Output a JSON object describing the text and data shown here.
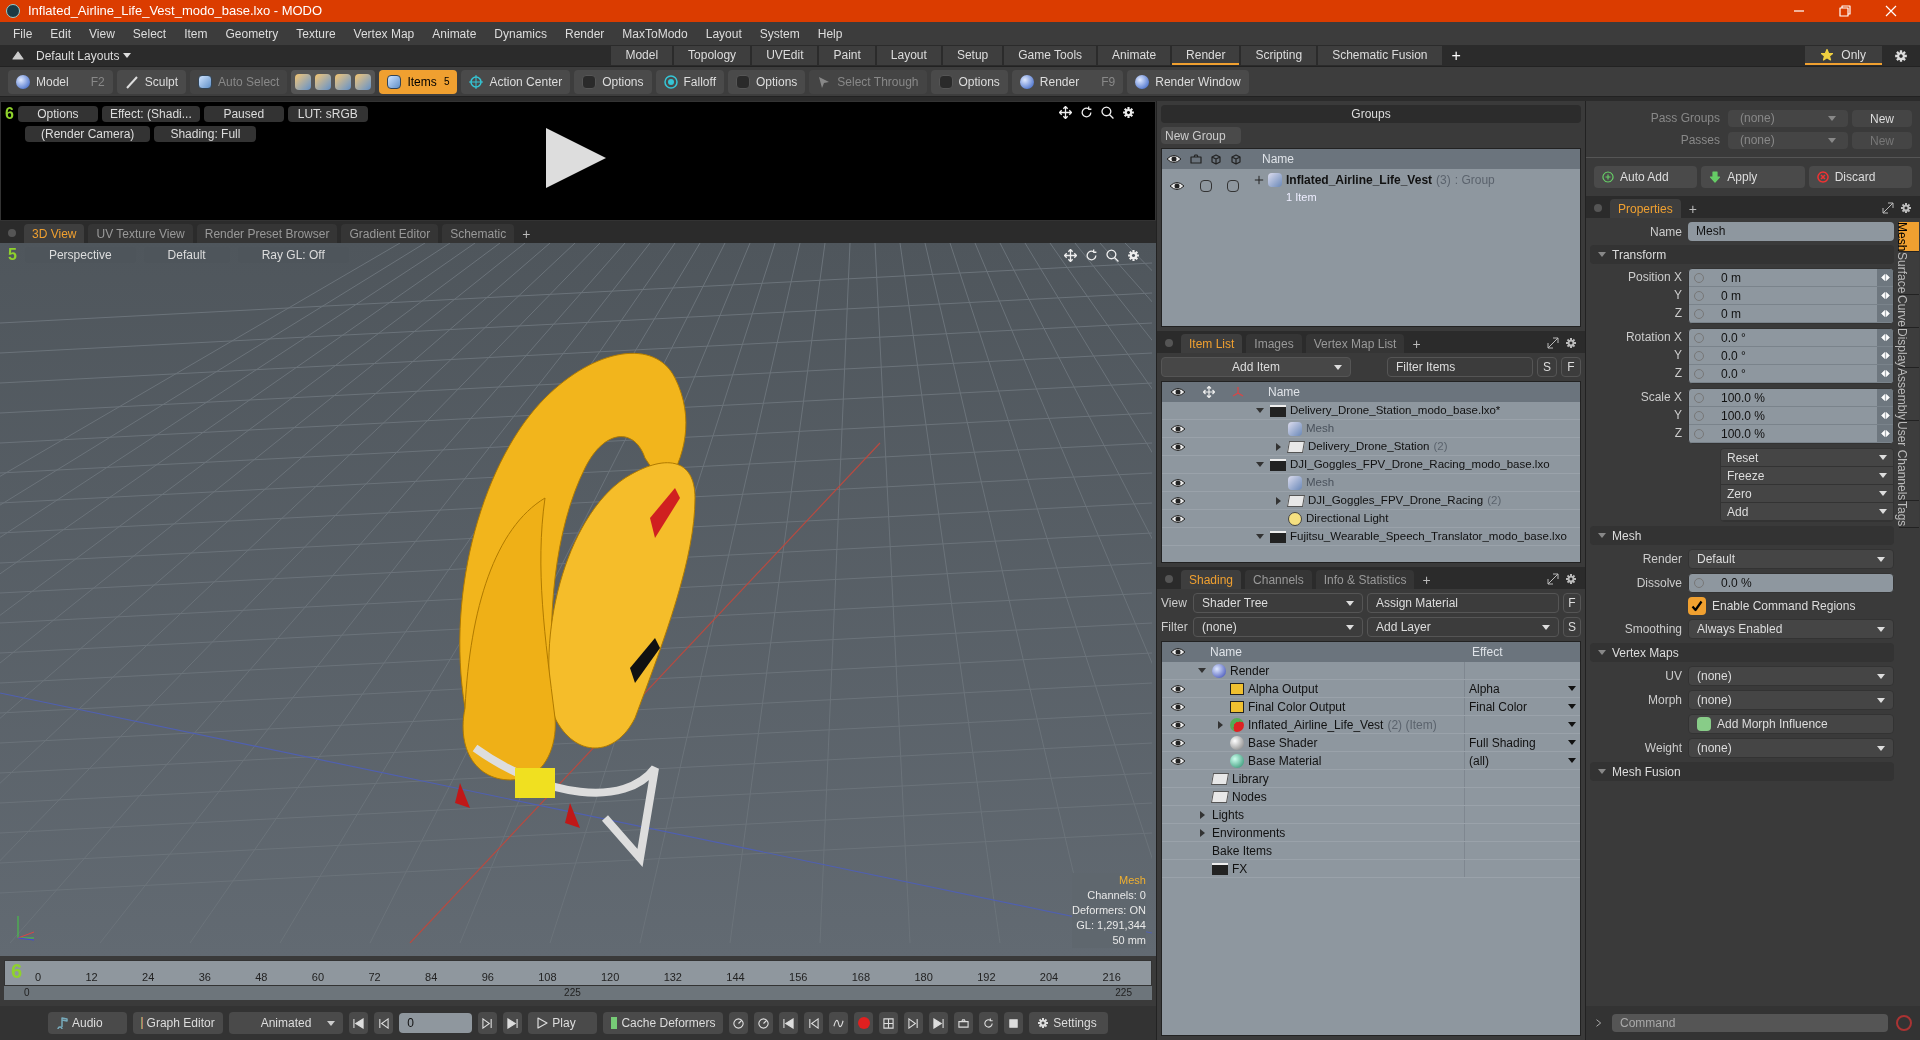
{
  "window": {
    "title": "Inflated_Airline_Life_Vest_modo_base.lxo - MODO"
  },
  "menu": [
    "File",
    "Edit",
    "View",
    "Select",
    "Item",
    "Geometry",
    "Texture",
    "Vertex Map",
    "Animate",
    "Dynamics",
    "Render",
    "MaxToModo",
    "Layout",
    "System",
    "Help"
  ],
  "layout_bar": {
    "layouts": "Default Layouts",
    "add": "+",
    "only": "Only",
    "tabs": [
      {
        "label": "Model",
        "selected": false
      },
      {
        "label": "Topology",
        "selected": false
      },
      {
        "label": "UVEdit",
        "selected": false
      },
      {
        "label": "Paint",
        "selected": false
      },
      {
        "label": "Layout",
        "selected": false
      },
      {
        "label": "Setup",
        "selected": false
      },
      {
        "label": "Game Tools",
        "selected": false
      },
      {
        "label": "Animate",
        "selected": false
      },
      {
        "label": "Render",
        "selected": true
      },
      {
        "label": "Scripting",
        "selected": false
      },
      {
        "label": "Schematic Fusion",
        "selected": false
      }
    ]
  },
  "toolbar": [
    {
      "kind": "sphere",
      "label": "Model",
      "shortcut": "F2"
    },
    {
      "kind": "brush",
      "label": "Sculpt"
    },
    {
      "kind": "cube",
      "label": "Auto Select",
      "disabled": true
    },
    {
      "kind": "cubes"
    },
    {
      "kind": "cube",
      "label": "Items",
      "selected": true,
      "badge": "5"
    },
    {
      "kind": "target",
      "label": "Action Center"
    },
    {
      "kind": "checkbox",
      "label": "Options"
    },
    {
      "kind": "falloff",
      "label": "Falloff"
    },
    {
      "kind": "checkbox",
      "label": "Options"
    },
    {
      "kind": "select",
      "label": "Select Through",
      "disabled": true
    },
    {
      "kind": "checkbox",
      "label": "Options"
    },
    {
      "kind": "render",
      "label": "Render",
      "shortcut": "F9"
    },
    {
      "kind": "render",
      "label": "Render Window"
    }
  ],
  "preview": {
    "layer": "6",
    "row1": [
      "Options",
      "Effect: (Shadi...",
      "Paused",
      "LUT: sRGB"
    ],
    "row2": [
      "(Render Camera)",
      "Shading: Full"
    ]
  },
  "viewport": {
    "tabs": [
      {
        "label": "3D View",
        "selected": true
      },
      {
        "label": "UV Texture View",
        "selected": false
      },
      {
        "label": "Render Preset Browser",
        "selected": false
      },
      {
        "label": "Gradient Editor",
        "selected": false
      },
      {
        "label": "Schematic",
        "selected": false
      }
    ],
    "add": "+",
    "layer": "5",
    "header": [
      "Perspective",
      "Default",
      "Ray GL: Off"
    ],
    "info_title": "Mesh",
    "info": [
      "Channels: 0",
      "Deformers: ON",
      "GL: 1,291,344",
      "50 mm"
    ]
  },
  "timeline": {
    "layer": "6",
    "ticks": [
      "0",
      "12",
      "24",
      "36",
      "48",
      "60",
      "72",
      "84",
      "96",
      "108",
      "120",
      "132",
      "144",
      "156",
      "168",
      "180",
      "192",
      "204",
      "216"
    ],
    "range_start": "0",
    "range_mid": "225",
    "range_end": "225"
  },
  "bottom_bar": {
    "audio": "Audio",
    "graph_editor": "Graph Editor",
    "mode": "Animated",
    "frame": "0",
    "play": "Play",
    "cache": "Cache Deformers",
    "settings": "Settings"
  },
  "groups": {
    "title": "Groups",
    "new_group": "New Group",
    "column": "Name",
    "rows": [
      {
        "name": "Inflated_Airline_Life_Vest",
        "count": "(3)",
        "type": ": Group",
        "sub": "1 Item"
      }
    ]
  },
  "item_list": {
    "tabs": [
      {
        "label": "Item List",
        "selected": true
      },
      {
        "label": "Images",
        "selected": false
      },
      {
        "label": "Vertex Map List",
        "selected": false
      }
    ],
    "add": "+",
    "add_item": "Add Item",
    "filter": "Filter Items",
    "s": "S",
    "f": "F",
    "column": "Name",
    "items": [
      {
        "kind": "scene",
        "name": "Delivery_Drone_Station_modo_base.lxo*",
        "expanded": true,
        "visible": false,
        "children": [
          {
            "kind": "mesh",
            "name": "Mesh",
            "visible": true
          },
          {
            "kind": "group",
            "name": "Delivery_Drone_Station",
            "count": "(2)",
            "expanded": false,
            "visible": true
          }
        ]
      },
      {
        "kind": "scene",
        "name": "DJI_Goggles_FPV_Drone_Racing_modo_base.lxo",
        "expanded": true,
        "visible": false,
        "children": [
          {
            "kind": "mesh",
            "name": "Mesh",
            "visible": true
          },
          {
            "kind": "group",
            "name": "DJI_Goggles_FPV_Drone_Racing",
            "count": "(2)",
            "expanded": false,
            "visible": true
          },
          {
            "kind": "light",
            "name": "Directional Light",
            "visible": true
          }
        ]
      },
      {
        "kind": "scene",
        "name": "Fujitsu_Wearable_Speech_Translator_modo_base.lxo",
        "expanded": true,
        "visible": false
      }
    ]
  },
  "shading": {
    "tabs": [
      {
        "label": "Shading",
        "selected": true
      },
      {
        "label": "Channels",
        "selected": false
      },
      {
        "label": "Info & Statistics",
        "selected": false
      }
    ],
    "add": "+",
    "view_label": "View",
    "view": "Shader Tree",
    "assign": "Assign Material",
    "f": "F",
    "filter_label": "Filter",
    "filter": "(none)",
    "add_layer": "Add Layer",
    "s": "S",
    "columns": [
      "Name",
      "Effect"
    ],
    "items": [
      {
        "kind": "render",
        "name": "Render",
        "expanded": true,
        "visible": false,
        "children": [
          {
            "kind": "output",
            "name": "Alpha Output",
            "effect": "Alpha",
            "visible": true
          },
          {
            "kind": "output",
            "name": "Final Color Output",
            "effect": "Final Color",
            "visible": true
          },
          {
            "kind": "material_group",
            "name": "Inflated_Airline_Life_Vest",
            "count": "(2) (Item)",
            "expanded": false,
            "visible": true,
            "effect_menu": true
          },
          {
            "kind": "shader",
            "name": "Base Shader",
            "effect": "Full Shading",
            "visible": true
          },
          {
            "kind": "material",
            "name": "Base Material",
            "effect": "(all)",
            "visible": true
          }
        ]
      },
      {
        "kind": "folder",
        "name": "Library",
        "visible": false
      },
      {
        "kind": "folder",
        "name": "Nodes",
        "visible": false
      },
      {
        "kind": "plain",
        "name": "Lights",
        "expanded": false,
        "visible": false
      },
      {
        "kind": "plain",
        "name": "Environments",
        "expanded": false,
        "visible": false
      },
      {
        "kind": "plain",
        "name": "Bake Items",
        "visible": false
      },
      {
        "kind": "fx",
        "name": "FX",
        "visible": false
      }
    ]
  },
  "passes": [
    {
      "label": "Pass Groups",
      "value": "(none)",
      "button": "New",
      "disabled": false
    },
    {
      "label": "Passes",
      "value": "(none)",
      "button": "New",
      "disabled": true
    }
  ],
  "pass_actions": [
    {
      "kind": "add",
      "label": "Auto Add"
    },
    {
      "kind": "apply",
      "label": "Apply"
    },
    {
      "kind": "discard",
      "label": "Discard"
    }
  ],
  "properties": {
    "tab": "Properties",
    "add": "+",
    "name_label": "Name",
    "name_value": "Mesh",
    "side_tabs": [
      {
        "label": "Mesh",
        "selected": true
      },
      {
        "label": "Surface",
        "selected": false
      },
      {
        "label": "Curve",
        "selected": false
      },
      {
        "label": "Display",
        "selected": false
      },
      {
        "label": "Assembly",
        "selected": false
      },
      {
        "label": "User Channels",
        "selected": false
      },
      {
        "label": "Tags",
        "selected": false
      }
    ],
    "sections": [
      {
        "title": "Transform",
        "expanded": true,
        "rows": [
          {
            "kind": "vector",
            "label": "Position",
            "axes": [
              {
                "axis": "X",
                "value": "0 m"
              },
              {
                "axis": "Y",
                "value": "0 m"
              },
              {
                "axis": "Z",
                "value": "0 m"
              }
            ]
          },
          {
            "kind": "vector",
            "label": "Rotation",
            "axes": [
              {
                "axis": "X",
                "value": "0.0 °"
              },
              {
                "axis": "Y",
                "value": "0.0 °"
              },
              {
                "axis": "Z",
                "value": "0.0 °"
              }
            ]
          },
          {
            "kind": "vector",
            "label": "Scale",
            "axes": [
              {
                "axis": "X",
                "value": "100.0 %"
              },
              {
                "axis": "Y",
                "value": "100.0 %"
              },
              {
                "axis": "Z",
                "value": "100.0 %"
              }
            ]
          },
          {
            "kind": "menus",
            "items": [
              "Reset",
              "Freeze",
              "Zero",
              "Add"
            ]
          }
        ]
      },
      {
        "title": "Mesh",
        "expanded": true,
        "rows": [
          {
            "kind": "dropdown",
            "label": "Render",
            "value": "Default"
          },
          {
            "kind": "number",
            "label": "Dissolve",
            "value": "0.0 %"
          },
          {
            "kind": "checkbox",
            "label": "Enable Command Regions",
            "checked": true
          },
          {
            "kind": "dropdown",
            "label": "Smoothing",
            "value": "Always Enabled"
          }
        ]
      },
      {
        "title": "Vertex Maps",
        "expanded": true,
        "rows": [
          {
            "kind": "dropdown",
            "label": "UV",
            "value": "(none)"
          },
          {
            "kind": "dropdown",
            "label": "Morph",
            "value": "(none)"
          },
          {
            "kind": "action",
            "label": "Add Morph Influence"
          },
          {
            "kind": "dropdown",
            "label": "Weight",
            "value": "(none)"
          }
        ]
      },
      {
        "title": "Mesh Fusion",
        "expanded": true
      }
    ]
  },
  "command": {
    "placeholder": "Command"
  }
}
